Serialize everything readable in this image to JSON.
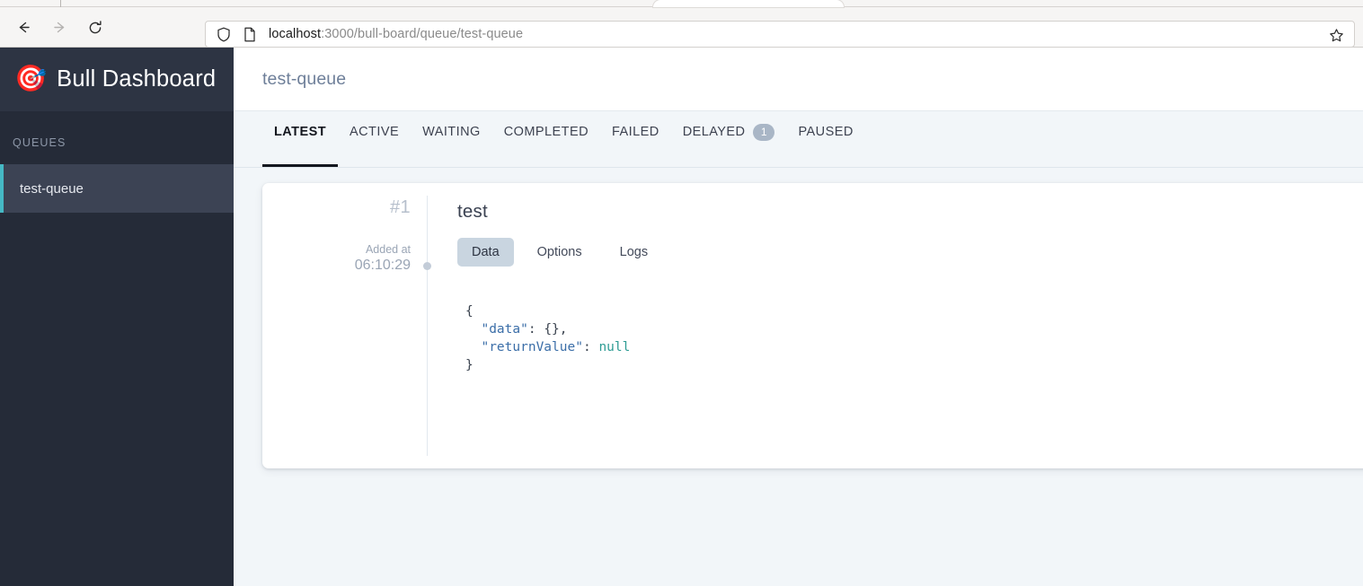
{
  "browser": {
    "nav": {
      "back": "back-arrow",
      "forward": "forward-arrow",
      "reload": "reload-arrow"
    },
    "url": {
      "host": "localhost",
      "path": ":3000/bull-board/queue/test-queue",
      "full": "localhost:3000/bull-board/queue/test-queue",
      "shield_icon": "shield-icon",
      "page_icon": "page-info-icon",
      "star_icon": "bookmark-star-icon"
    }
  },
  "sidebar": {
    "logo_glyph": "🎯",
    "brand_title": "Bull Dashboard",
    "section_label": "QUEUES",
    "accent_color": "#45b8c4",
    "background_color": "#252b38",
    "queues": [
      {
        "label": "test-queue",
        "active": true
      }
    ]
  },
  "main": {
    "header": {
      "title": "test-queue"
    },
    "tabs": [
      {
        "label": "LATEST",
        "active": true,
        "badge": null
      },
      {
        "label": "ACTIVE",
        "active": false,
        "badge": null
      },
      {
        "label": "WAITING",
        "active": false,
        "badge": null
      },
      {
        "label": "COMPLETED",
        "active": false,
        "badge": null
      },
      {
        "label": "FAILED",
        "active": false,
        "badge": null
      },
      {
        "label": "DELAYED",
        "active": false,
        "badge": "1"
      },
      {
        "label": "PAUSED",
        "active": false,
        "badge": null
      }
    ],
    "job": {
      "id": "#1",
      "added_label": "Added at",
      "added_time": "06:10:29",
      "name": "test",
      "detail_tabs": [
        {
          "label": "Data",
          "active": true
        },
        {
          "label": "Options",
          "active": false
        },
        {
          "label": "Logs",
          "active": false
        }
      ],
      "json": {
        "line1": "{",
        "line2_key": "\"data\"",
        "line2_rest": ": {},",
        "line3_key": "\"returnValue\"",
        "line3_colon": ": ",
        "line3_value": "null",
        "line4": "}"
      }
    }
  }
}
